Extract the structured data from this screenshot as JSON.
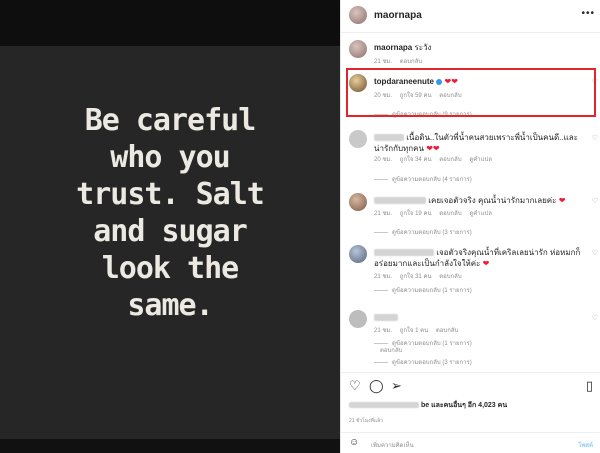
{
  "image": {
    "quote_lines": [
      "Be careful",
      "who you",
      "trust. Salt",
      "and sugar",
      "look the",
      "same."
    ]
  },
  "post": {
    "author": "maornapa",
    "more_icon": "more-dots-icon",
    "comments": [
      {
        "user": "maornapa",
        "text": "ระวัง",
        "meta": [
          "21 ชม.",
          "ตอบกลับ"
        ]
      },
      {
        "user": "topdaraneenute",
        "text": "❤❤",
        "meta": [
          "20 ชม.",
          "ถูกใจ 59 คน",
          "ตอบกลับ"
        ],
        "replies": "ดูข้อความตอบกลับ (9 รายการ)"
      },
      {
        "text_visible": "เนื้อดิน..ในตัวพี่น้ำคนสวยเพราะพี่น้ำเป็นคนดี..และน่ารักกับทุกคน",
        "meta": [
          "20 ชม.",
          "ถูกใจ 34 คน",
          "ตอบกลับ",
          "ดูคำแปล"
        ],
        "replies": "ดูข้อความตอบกลับ (4 รายการ)"
      },
      {
        "text_visible": "เคยเจอตัวจริง คุณน้ำน่ารักมากเลยค่ะ",
        "meta": [
          "21 ชม.",
          "ถูกใจ 19 คน",
          "ตอบกลับ",
          "ดูคำแปล"
        ],
        "replies": "ดูข้อความตอบกลับ (3 รายการ)"
      },
      {
        "text_visible": "เจอตัวจริงคุณน้ำที่เคริลเลยน่ารัก ห่อหมกก็อร่อยมากและเป็นกำลังใจให้ค่ะ",
        "meta": [
          "21 ชม.",
          "ถูกใจ 31 คน",
          "ตอบกลับ"
        ],
        "replies": "ดูข้อความตอบกลับ (1 รายการ)"
      },
      {
        "text_visible": "",
        "meta": [
          "21 ชม.",
          "ถูกใจ 1 คน",
          "ตอบกลับ"
        ],
        "replies": "ดูข้อความตอบกลับ (1 รายการ)"
      },
      {
        "text_visible": "",
        "meta": [
          "",
          "ตอบกลับ"
        ],
        "replies": "ดูข้อความตอบกลับ (3 รายการ)"
      }
    ],
    "likes_text": "be และคนอื่นๆ อีก 4,023 คน",
    "time_ago": "21 ชั่วโมงที่แล้ว",
    "add_comment_placeholder": "เพิ่มความคิดเห็น",
    "post_label": "โพสต์"
  },
  "colors": {
    "highlight": "#e0252c",
    "heart": "#ed1c3a",
    "link": "#3897f0"
  }
}
